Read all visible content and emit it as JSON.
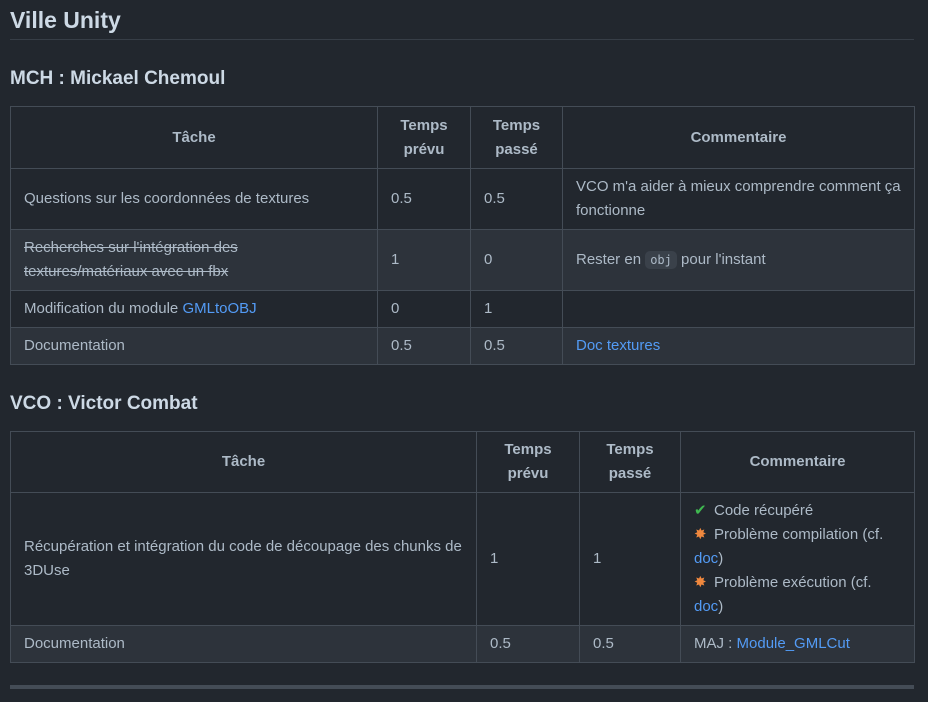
{
  "page_title": "Ville Unity",
  "sections": [
    {
      "heading": "MCH : Mickael Chemoul",
      "headers": [
        "Tâche",
        "Temps prévu",
        "Temps passé",
        "Commentaire"
      ],
      "rows": [
        {
          "task": "Questions sur les coordonnées de textures",
          "prevu": "0.5",
          "passe": "0.5",
          "comment": "VCO m'a aider à mieux comprendre comment ça fonctionne"
        },
        {
          "task": "Recherches sur l'intégration des textures/matériaux avec un fbx",
          "prevu": "1",
          "passe": "0",
          "comment_pre": "Rester en ",
          "comment_code": "obj",
          "comment_post": " pour l'instant"
        },
        {
          "task_pre": "Modification du module ",
          "task_link": "GMLtoOBJ",
          "prevu": "0",
          "passe": "1",
          "comment": ""
        },
        {
          "task": "Documentation",
          "prevu": "0.5",
          "passe": "0.5",
          "comment_link": "Doc textures"
        }
      ]
    },
    {
      "heading": "VCO : Victor Combat",
      "headers": [
        "Tâche",
        "Temps prévu",
        "Temps passé",
        "Commentaire"
      ],
      "rows": [
        {
          "task": "Récupération et intégration du code de découpage des chunks de 3DUse",
          "prevu": "1",
          "passe": "1",
          "comment_lines": [
            {
              "icon": "check-mark-icon",
              "text": "Code récupéré"
            },
            {
              "icon": "collision-icon",
              "text": "Problème compilation (cf. ",
              "link": "doc",
              "tail": ")"
            },
            {
              "icon": "collision-icon",
              "text": "Problème exécution (cf. ",
              "link": "doc",
              "tail": ")"
            }
          ]
        },
        {
          "task": "Documentation",
          "prevu": "0.5",
          "passe": "0.5",
          "comment_pre": "MAJ : ",
          "comment_link": "Module_GMLCut"
        }
      ]
    }
  ]
}
